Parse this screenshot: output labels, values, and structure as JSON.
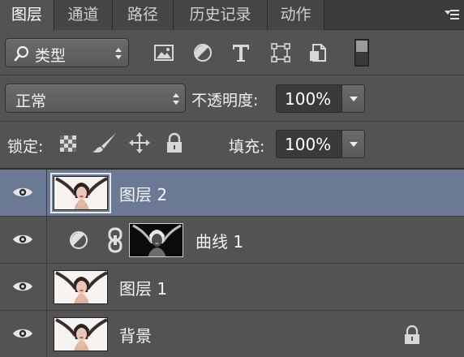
{
  "tabs": [
    {
      "label": "图层",
      "active": true
    },
    {
      "label": "通道",
      "active": false
    },
    {
      "label": "路径",
      "active": false
    },
    {
      "label": "历史记录",
      "active": false
    },
    {
      "label": "动作",
      "active": false
    }
  ],
  "filter": {
    "type_label": "类型",
    "icons": [
      "image-filter-icon",
      "adjustment-filter-icon",
      "text-filter-icon",
      "shape-filter-icon",
      "smart-object-filter-icon"
    ]
  },
  "blend": {
    "mode": "正常",
    "opacity_label": "不透明度:",
    "opacity_value": "100%"
  },
  "lock": {
    "label": "锁定:",
    "fill_label": "填充:",
    "fill_value": "100%"
  },
  "layers": [
    {
      "name": "图层 2",
      "selected": true,
      "kind": "pixel"
    },
    {
      "name": "曲线 1",
      "selected": false,
      "kind": "adjustment"
    },
    {
      "name": "图层 1",
      "selected": false,
      "kind": "pixel"
    },
    {
      "name": "背景",
      "selected": false,
      "kind": "background",
      "locked": true
    }
  ],
  "colors": {
    "panel_bg": "#535353",
    "selected_row": "#6a7a94",
    "field_bg": "#3a3a3a"
  }
}
